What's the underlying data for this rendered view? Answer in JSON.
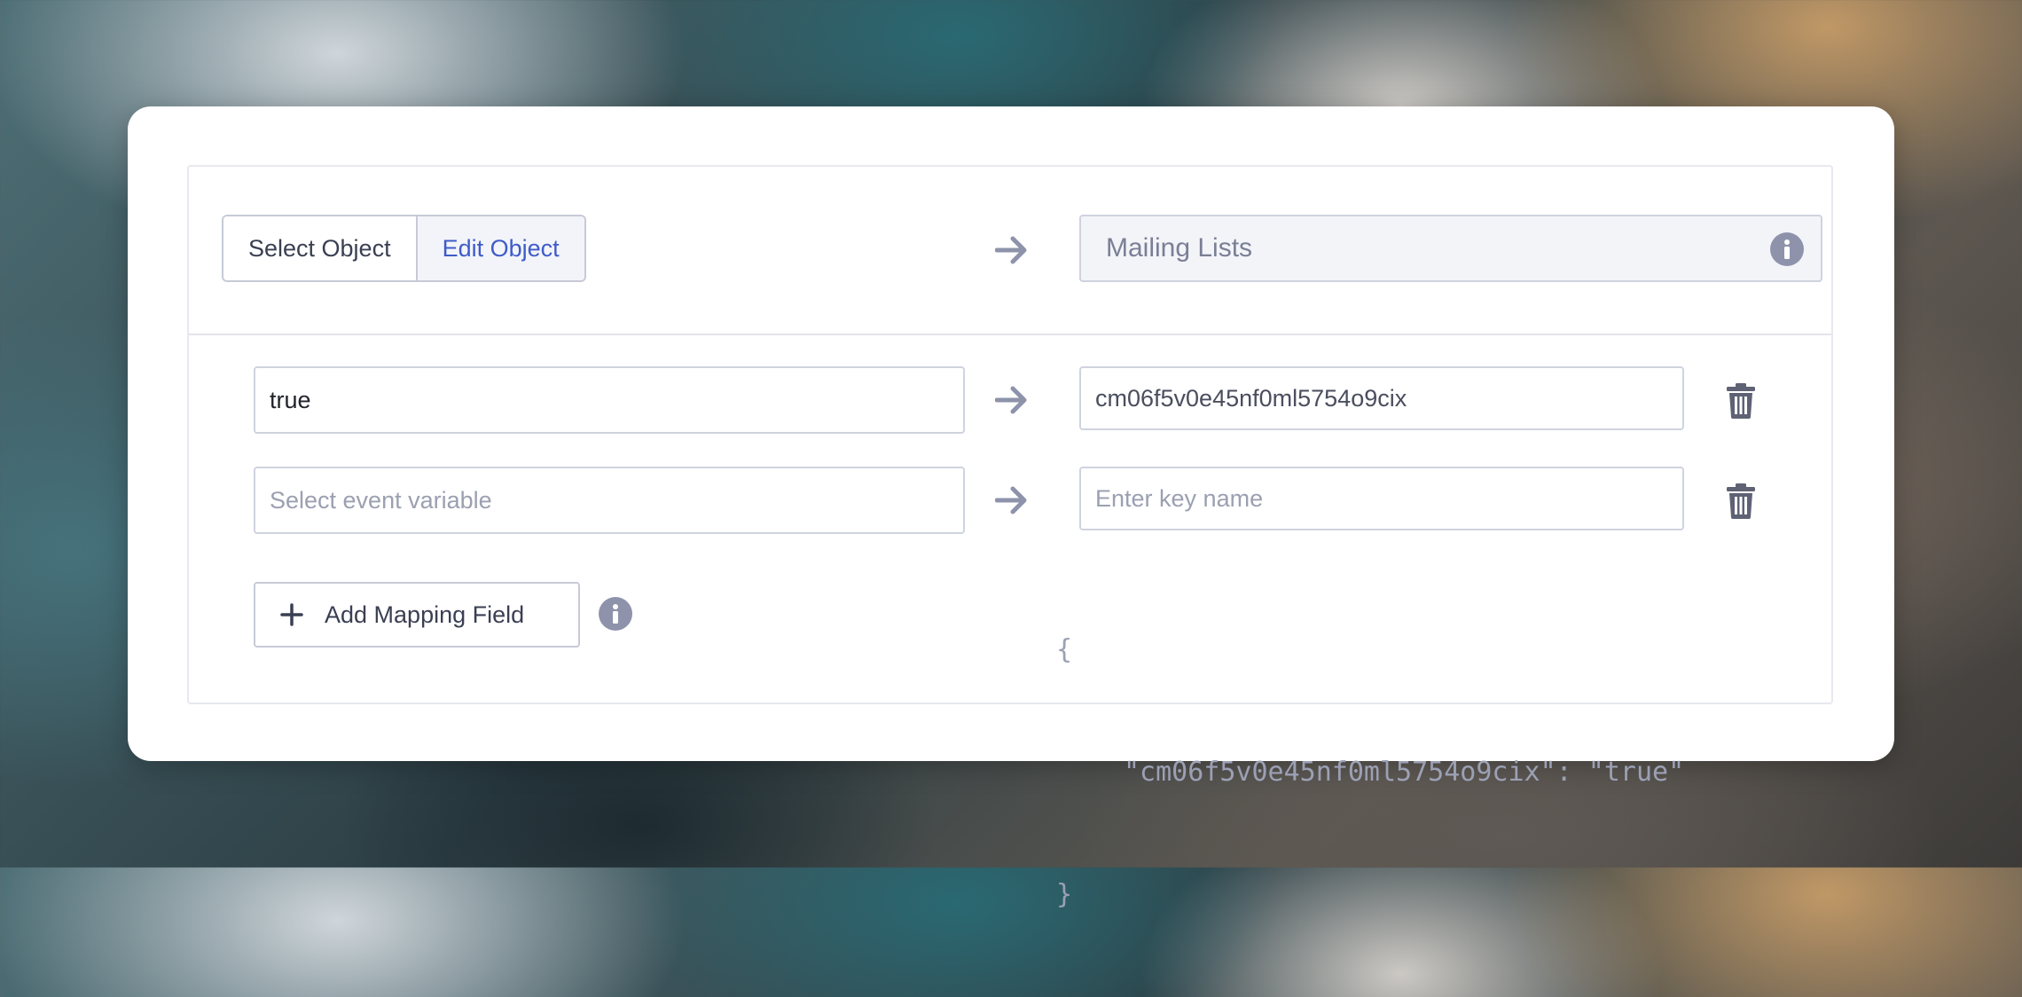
{
  "object_selector": {
    "options": [
      {
        "label": "Select Object",
        "active": false
      },
      {
        "label": "Edit Object",
        "active": true
      }
    ]
  },
  "target_object": {
    "value": "Mailing Lists",
    "info_icon": "info-icon"
  },
  "mappings": [
    {
      "source_value": "true",
      "source_placeholder": "Select event variable",
      "key_value": "cm06f5v0e45nf0ml5754o9cix",
      "key_placeholder": "Enter key name"
    },
    {
      "source_value": "",
      "source_placeholder": "Select event variable",
      "key_value": "",
      "key_placeholder": "Enter key name"
    }
  ],
  "add_button": {
    "label": "Add Mapping Field",
    "icon": "plus-icon"
  },
  "json_preview": {
    "open": "{",
    "entry": "\"cm06f5v0e45nf0ml5754o9cix\": \"true\"",
    "close": "}"
  },
  "colors": {
    "accent": "#3f5bc8",
    "icon": "#8e93ab",
    "trash": "#5f6275"
  }
}
